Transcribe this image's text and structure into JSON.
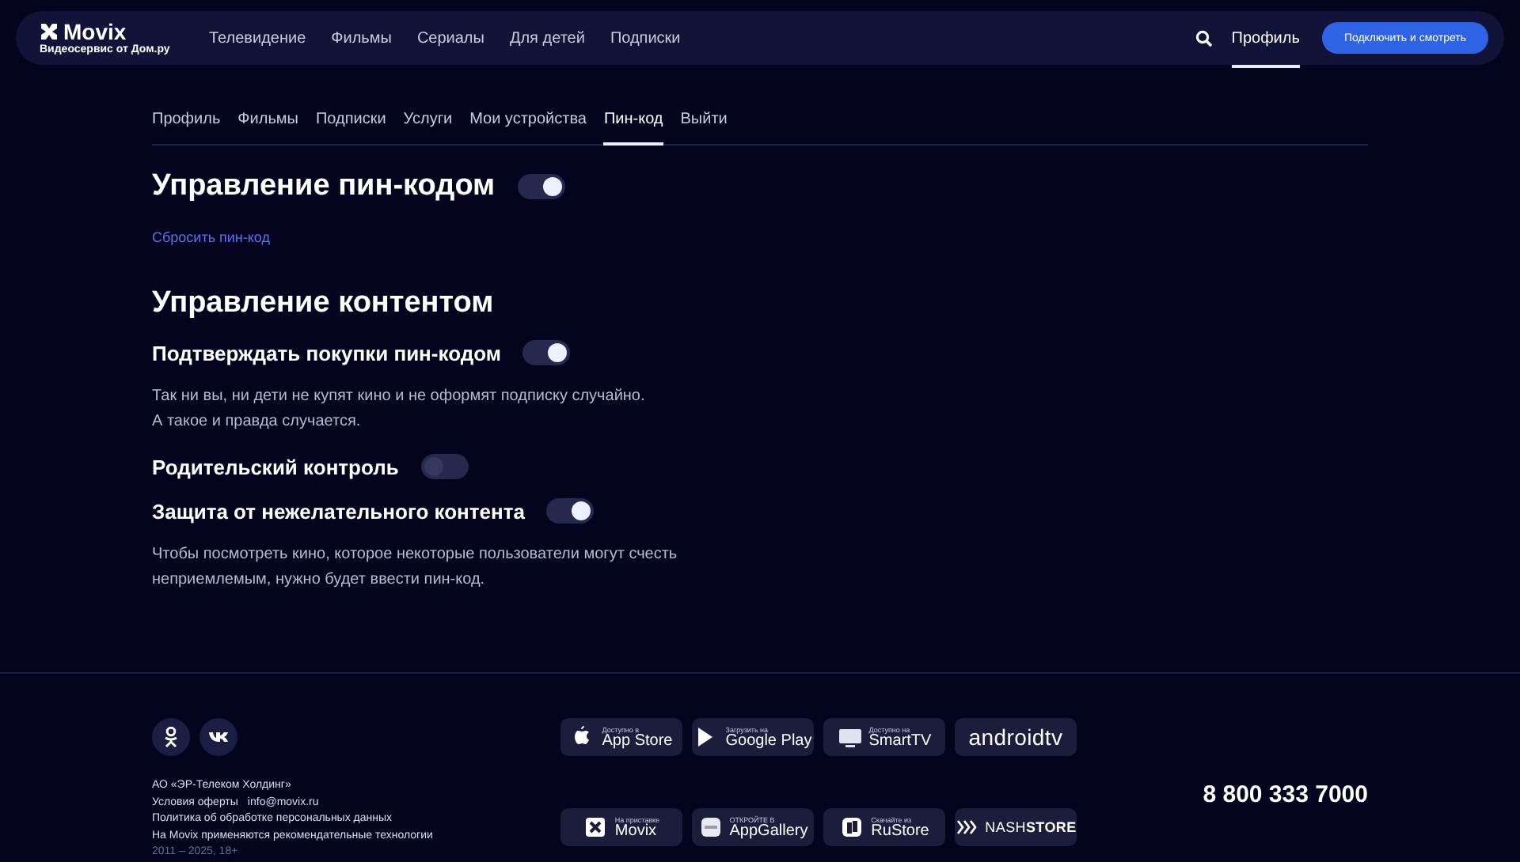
{
  "header": {
    "logo": "Movix",
    "tagline": "Видеосервис от Дом.ру",
    "nav": [
      {
        "label": "Телевидение"
      },
      {
        "label": "Фильмы"
      },
      {
        "label": "Сериалы"
      },
      {
        "label": "Для детей"
      },
      {
        "label": "Подписки"
      }
    ],
    "profile": {
      "label": "Профиль",
      "selected": true
    },
    "cta": "Подключить и смотреть"
  },
  "tabs": [
    {
      "label": "Профиль",
      "selected": false
    },
    {
      "label": "Фильмы",
      "selected": false
    },
    {
      "label": "Подписки",
      "selected": false
    },
    {
      "label": "Услуги",
      "selected": false
    },
    {
      "label": "Мои устройства",
      "selected": false
    },
    {
      "label": "Пин-код",
      "selected": true
    },
    {
      "label": "Выйти",
      "selected": false
    }
  ],
  "pin": {
    "title": "Управление пин-кодом",
    "on": true,
    "reset_link": "Сбросить пин-код"
  },
  "content": {
    "title": "Управление контентом",
    "settings": [
      {
        "label": "Подтверждать покупки пин-кодом",
        "on": true,
        "description": "Так ни вы, ни дети не купят кино и не оформят подписку случайно.\nА такое и правда случается."
      },
      {
        "label": "Родительский контроль",
        "on": false
      },
      {
        "label": "Защита от нежелательного контента",
        "on": true,
        "description": "Чтобы посмотреть кино, которое некоторые пользователи могут счесть\nнеприемлемым, нужно будет ввести пин-код."
      }
    ]
  },
  "footer": {
    "company": "АО «ЭР-Телеком Холдинг»",
    "links": [
      "Условия оферты",
      "info@movix.ru"
    ],
    "policy": "Политика об обработке персональных данных",
    "tech": "На Movix применяются рекомендательные технологии",
    "years": "2011 – 2025, 18+",
    "stores": [
      {
        "kind": "badge",
        "caption": "Доступно в",
        "name": "App Store"
      },
      {
        "kind": "badge",
        "caption": "Загрузить на",
        "name": "Google Play"
      },
      {
        "kind": "badge",
        "caption": "Доступно на",
        "name": "SmartTV"
      },
      {
        "kind": "wordmark",
        "name": "androidtv"
      },
      {
        "kind": "badge",
        "caption": "На приставке",
        "name": "Movix"
      },
      {
        "kind": "badge",
        "caption": "ОТКРОЙТЕ В",
        "name": "AppGallery"
      },
      {
        "kind": "badge",
        "caption": "Скачайте из",
        "name": "RuStore"
      },
      {
        "kind": "wordmark",
        "name": "NASH**STORE**"
      }
    ],
    "phone": "8 800 333 7000"
  }
}
